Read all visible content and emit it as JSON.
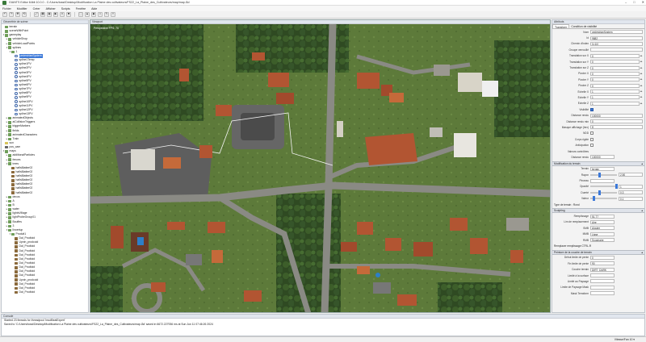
{
  "window": {
    "title": "GIANTS Editor 64bit 10.0.0 - C:/Users/tossi/Desktop/Modification La Plaine des cultivateurs/FS22_La_Plaine_des_Cultivateurs/map/map.i3d",
    "controls": [
      "–",
      "□",
      "✕"
    ]
  },
  "menu": [
    "Fichier",
    "Modifier",
    "Créer",
    "Afficher",
    "Scripts",
    "Fenêtre",
    "Aide"
  ],
  "toolbar": {
    "buttons": [
      "↶",
      "↷",
      "✥",
      "⟲",
      "⤢",
      "▦",
      "◉",
      "▶",
      "⏸",
      "■",
      "⬚",
      "▲",
      "◆",
      "⌂",
      "✎",
      "⌖"
    ]
  },
  "left_panel": {
    "title": "Géométrie de scène",
    "items": [
      {
        "d": 0,
        "exp": "",
        "icon": "t-node",
        "label": "terrain"
      },
      {
        "d": 0,
        "exp": "",
        "icon": "t-node",
        "label": "sceneWithPoint"
      },
      {
        "d": 0,
        "exp": "▾",
        "icon": "t-node",
        "label": "gameplay"
      },
      {
        "d": 1,
        "exp": "▸",
        "icon": "t-node",
        "label": "vehicleShop"
      },
      {
        "d": 1,
        "exp": "▸",
        "icon": "t-node",
        "label": "vehicleLoadPoints"
      },
      {
        "d": 1,
        "exp": "▾",
        "icon": "t-node",
        "label": "splines"
      },
      {
        "d": 2,
        "exp": "▾",
        "icon": "t-node",
        "label": "1"
      },
      {
        "d": 3,
        "exp": "",
        "icon": "t-spline",
        "label": "pedestrianSystem",
        "sel": true
      },
      {
        "d": 3,
        "exp": "",
        "icon": "t-spline",
        "label": "spline1Temp"
      },
      {
        "d": 3,
        "exp": "",
        "icon": "t-spline",
        "label": "spline1PV"
      },
      {
        "d": 3,
        "exp": "",
        "icon": "t-spline",
        "label": "spline2PV"
      },
      {
        "d": 3,
        "exp": "",
        "icon": "t-spline",
        "label": "spline3PV"
      },
      {
        "d": 3,
        "exp": "",
        "icon": "t-spline",
        "label": "spline4PV"
      },
      {
        "d": 3,
        "exp": "",
        "icon": "t-spline",
        "label": "spline5PV"
      },
      {
        "d": 3,
        "exp": "",
        "icon": "t-spline",
        "label": "spline6PV"
      },
      {
        "d": 3,
        "exp": "",
        "icon": "t-spline",
        "label": "spline7PV"
      },
      {
        "d": 3,
        "exp": "",
        "icon": "t-spline",
        "label": "spline8PV"
      },
      {
        "d": 3,
        "exp": "",
        "icon": "t-spline",
        "label": "spline9PV"
      },
      {
        "d": 3,
        "exp": "",
        "icon": "t-spline",
        "label": "spline10PV"
      },
      {
        "d": 3,
        "exp": "",
        "icon": "t-spline",
        "label": "spline11PV"
      },
      {
        "d": 3,
        "exp": "",
        "icon": "t-spline",
        "label": "spline12PV"
      },
      {
        "d": 3,
        "exp": "",
        "icon": "t-spline",
        "label": "spline13PV"
      },
      {
        "d": 1,
        "exp": "▸",
        "icon": "t-node",
        "label": "animatedObjects"
      },
      {
        "d": 1,
        "exp": "▸",
        "icon": "t-node",
        "label": "aiCollisionTriggers"
      },
      {
        "d": 1,
        "exp": "▸",
        "icon": "t-node",
        "label": "triggerMarkers"
      },
      {
        "d": 1,
        "exp": "▸",
        "icon": "t-node",
        "label": "fields"
      },
      {
        "d": 1,
        "exp": "▸",
        "icon": "t-node",
        "label": "animatedCharacters"
      },
      {
        "d": 1,
        "exp": "▸",
        "icon": "t-node",
        "label": "Train"
      },
      {
        "d": 0,
        "exp": "",
        "icon": "t-light",
        "label": "sun"
      },
      {
        "d": 0,
        "exp": "",
        "icon": "t-camera",
        "label": "pos_cam"
      },
      {
        "d": 0,
        "exp": "▾",
        "icon": "t-node",
        "label": "maps"
      },
      {
        "d": 1,
        "exp": "▸",
        "icon": "t-node",
        "label": "additionalParticles"
      },
      {
        "d": 1,
        "exp": "▸",
        "icon": "t-node",
        "label": "fences"
      },
      {
        "d": 1,
        "exp": "▾",
        "icon": "t-node",
        "label": "trees"
      },
      {
        "d": 2,
        "exp": "",
        "icon": "t-shape",
        "label": "haflsBlatter02"
      },
      {
        "d": 2,
        "exp": "",
        "icon": "t-shape",
        "label": "haflsBlatter02"
      },
      {
        "d": 2,
        "exp": "",
        "icon": "t-shape",
        "label": "haflsBlatter02"
      },
      {
        "d": 2,
        "exp": "",
        "icon": "t-shape",
        "label": "haflsBlatter02"
      },
      {
        "d": 2,
        "exp": "",
        "icon": "t-shape",
        "label": "haflsBlatter02"
      },
      {
        "d": 2,
        "exp": "",
        "icon": "t-shape",
        "label": "haflsBlatter02"
      },
      {
        "d": 2,
        "exp": "",
        "icon": "t-shape",
        "label": "haflsBlatter02"
      },
      {
        "d": 1,
        "exp": "▸",
        "icon": "t-node",
        "label": "decos"
      },
      {
        "d": 1,
        "exp": "▸",
        "icon": "t-node",
        "label": "A"
      },
      {
        "d": 1,
        "exp": "▸",
        "icon": "t-node",
        "label": "B"
      },
      {
        "d": 1,
        "exp": "▸",
        "icon": "t-node",
        "label": "water"
      },
      {
        "d": 1,
        "exp": "▸",
        "icon": "t-node",
        "label": "lightsVillage"
      },
      {
        "d": 1,
        "exp": "▸",
        "icon": "t-node",
        "label": "lightProbeGroup01"
      },
      {
        "d": 1,
        "exp": "▸",
        "icon": "t-node",
        "label": "Bouffes"
      },
      {
        "d": 1,
        "exp": "▸",
        "icon": "t-node",
        "label": "3"
      },
      {
        "d": 1,
        "exp": "▾",
        "icon": "t-node",
        "label": "lincertup"
      },
      {
        "d": 2,
        "exp": "▾",
        "icon": "t-node",
        "label": "Produit1"
      },
      {
        "d": 3,
        "exp": "",
        "icon": "t-shape",
        "label": "Dal_Prodtoid"
      },
      {
        "d": 3,
        "exp": "",
        "icon": "t-shape",
        "label": "Upnin_prodcoid"
      },
      {
        "d": 3,
        "exp": "",
        "icon": "t-shape",
        "label": "Dal_Prodtoid"
      },
      {
        "d": 3,
        "exp": "",
        "icon": "t-shape",
        "label": "Dal_Prodtoid"
      },
      {
        "d": 3,
        "exp": "",
        "icon": "t-shape",
        "label": "Dal_Prodtoid"
      },
      {
        "d": 3,
        "exp": "",
        "icon": "t-shape",
        "label": "Dal_Prodtoid"
      },
      {
        "d": 3,
        "exp": "",
        "icon": "t-shape",
        "label": "Dal_Prodtoid"
      },
      {
        "d": 3,
        "exp": "",
        "icon": "t-shape",
        "label": "Dal_Prodtoid"
      },
      {
        "d": 3,
        "exp": "",
        "icon": "t-shape",
        "label": "Dal_Prodtoid"
      },
      {
        "d": 3,
        "exp": "",
        "icon": "t-shape",
        "label": "Dal_Prodtoid"
      },
      {
        "d": 3,
        "exp": "",
        "icon": "t-shape",
        "label": "Upnin_prodcoid"
      },
      {
        "d": 3,
        "exp": "",
        "icon": "t-shape",
        "label": "Dal_Prodtoid"
      },
      {
        "d": 3,
        "exp": "",
        "icon": "t-shape",
        "label": "Dal_Prodtoid"
      },
      {
        "d": 3,
        "exp": "",
        "icon": "t-shape",
        "label": "Dal_Prodtoid"
      }
    ]
  },
  "viewport": {
    "title": "Viewport",
    "overlay": "Perspective  FPS: 70"
  },
  "right_panel": {
    "title": "Attributs",
    "tabs": [
      "Transform",
      "Condition de visibilité"
    ],
    "fields": [
      {
        "k": "Nom",
        "v": "pedestrianSystem"
      },
      {
        "k": "Id",
        "v": "9882"
      },
      {
        "k": "Chemin d'index",
        "v": "0>1|0"
      },
      {
        "k": "Groupe verrouillé",
        "v": ""
      },
      {
        "k": "Translation sur X",
        "v": "0"
      },
      {
        "k": "Translation sur Y",
        "v": "0"
      },
      {
        "k": "Translation sur Z",
        "v": "0"
      },
      {
        "k": "Pivoter X",
        "v": "0"
      },
      {
        "k": "Pivoter Y",
        "v": "0"
      },
      {
        "k": "Pivoter Z",
        "v": "0"
      },
      {
        "k": "Échelle X",
        "v": "1"
      },
      {
        "k": "Échelle Y",
        "v": "1"
      },
      {
        "k": "Échelle Z",
        "v": "1"
      }
    ],
    "visibility": {
      "label": "Visibilité",
      "checked": true
    },
    "fields2": [
      {
        "k": "Distance rendu",
        "v": "100000"
      },
      {
        "k": "Distance rendu min",
        "v": "0"
      },
      {
        "k": "Masque affichage (hex)",
        "v": "ff"
      }
    ],
    "checks": [
      {
        "label": "NDD",
        "checked": false
      },
      {
        "label": "Corps rigide",
        "checked": false
      },
      {
        "label": "Anticipation",
        "checked": false
      }
    ],
    "misc": [
      "Valeurs contrôlées",
      "Distance rendu"
    ],
    "misc_value": "100000",
    "sections": [
      {
        "title": "Modification du terrain",
        "items": [
          {
            "k": "Terrain",
            "v": "terrain"
          },
          {
            "k": "Rayon",
            "v": "2.50",
            "slider": 0.3
          },
          {
            "k": "Pinceau",
            "v": ""
          },
          {
            "k": "Opacité",
            "v": "1",
            "slider": 0.95
          },
          {
            "k": "Dureté",
            "v": "0.3",
            "slider": 0.3
          },
          {
            "k": "Valeur",
            "v": "0.1",
            "slider": 0.1
          }
        ],
        "footer": "Type de terrain : Rond"
      },
      {
        "title": "Sculpting",
        "items": [
          {
            "k": "Remplissage",
            "v": "51.77"
          },
          {
            "k": "Lim de remplacement",
            "v": "Aire"
          },
          {
            "k": "SMB",
            "v": "Ajouter"
          },
          {
            "k": "MMB",
            "v": "Lisse"
          },
          {
            "k": "RMB",
            "v": "Soustraire"
          }
        ],
        "footer": "Remplacer remplissage  CTRL-R"
      },
      {
        "title": "Peinture de la couche de terrain",
        "items": [
          {
            "k": "Début limite de pente",
            "v": "0"
          },
          {
            "k": "Fin limite de pente",
            "v": "90"
          },
          {
            "k": "Couche terrain",
            "v": "DIRT_DARK"
          },
          {
            "k": "Limité à la surface",
            "v": ""
          },
          {
            "k": "Limité au Paysage",
            "v": ""
          },
          {
            "k": "Limite de Paysage Mask",
            "v": ""
          },
          {
            "k": "Mask Terraform",
            "v": ""
          }
        ]
      }
    ]
  },
  "console": {
    "title": "Console",
    "lines": [
      "Started 23 threads for threadpool 'insolBeatExpert'",
      "Saved to 'C:/Users/tossi/Desktop/Modification La Plaine des cultivateurs/FS22_La_Plaine_des_Cultivateurs/map.i3d' saved in 6672.227936 ms at Sun Jun 11 07:46:26 2024"
    ]
  },
  "status": {
    "left": "",
    "right": "Vitesse/Fan  10 ▾"
  }
}
